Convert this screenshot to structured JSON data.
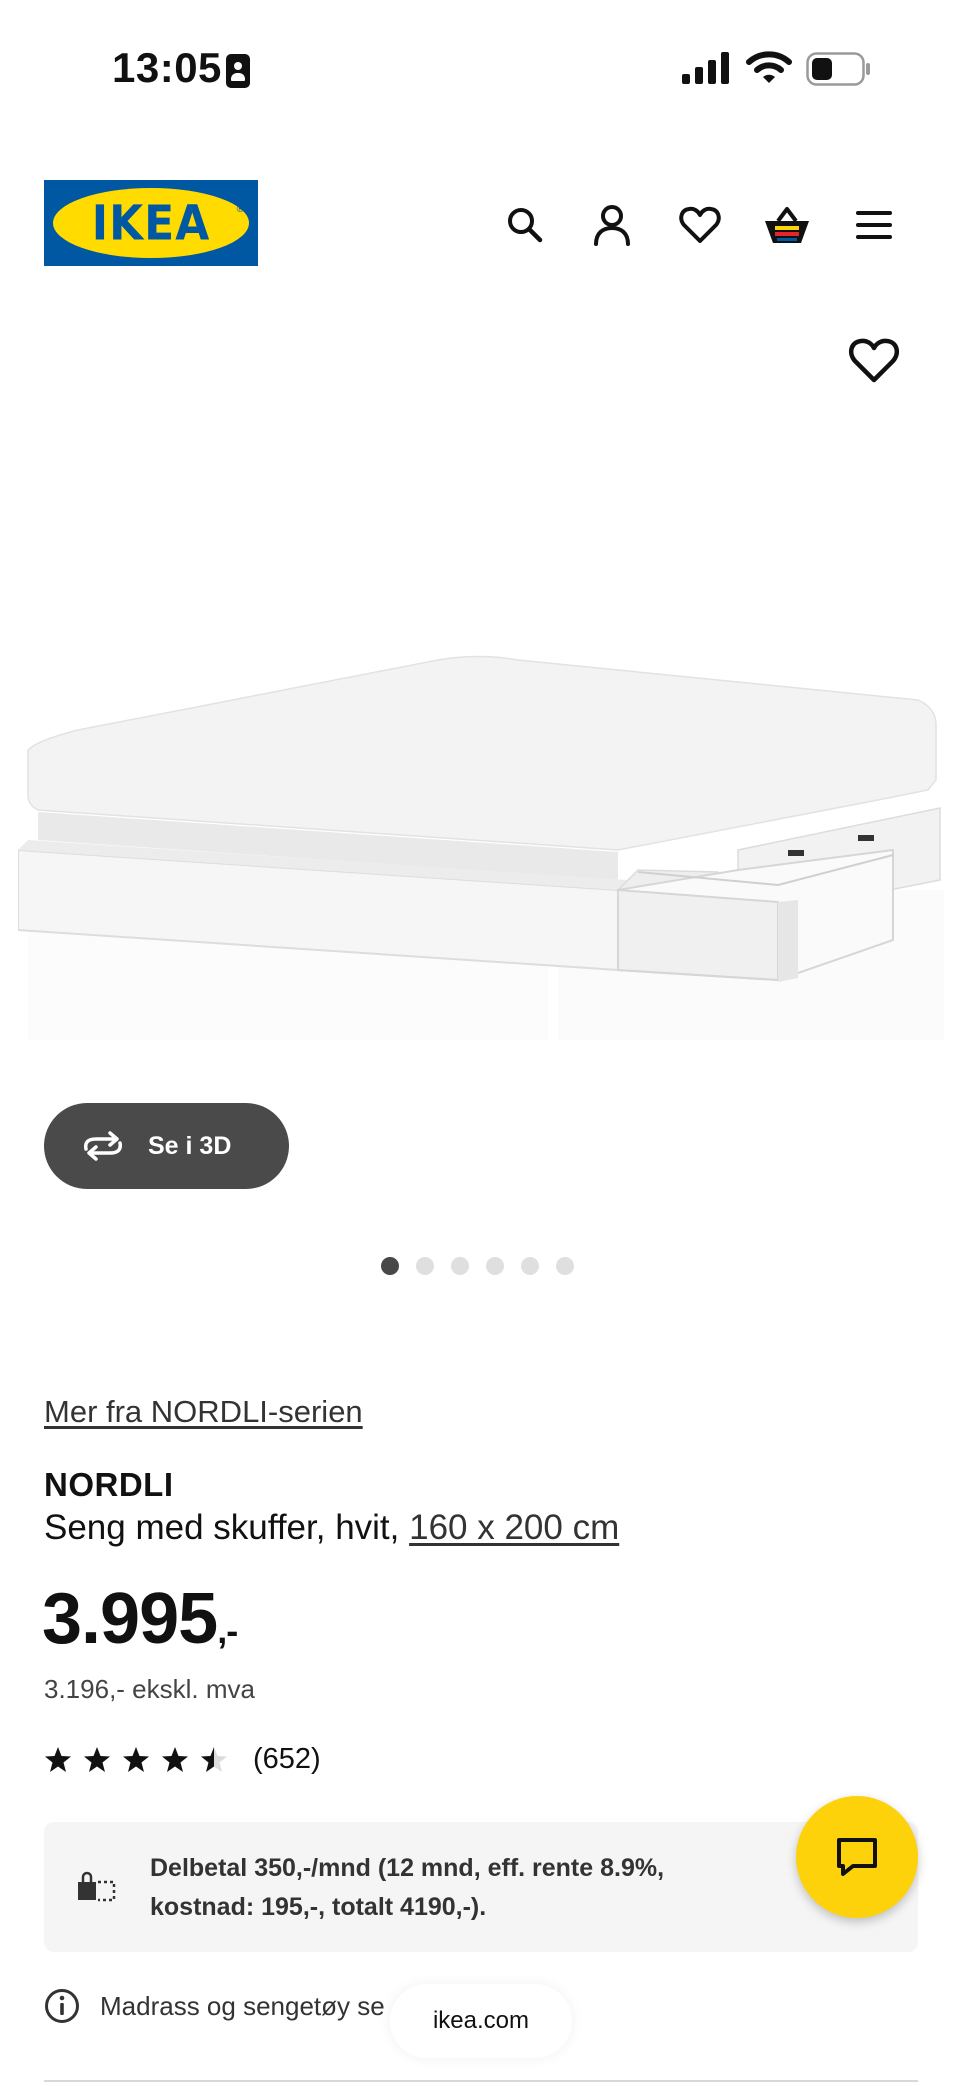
{
  "status_bar": {
    "time": "13:05"
  },
  "header": {
    "logo_text": "IKEA",
    "logo_reg": "®",
    "brand_colors": {
      "blue": "#0058a3",
      "yellow": "#ffdb00"
    },
    "icons": [
      "search-icon",
      "account-icon",
      "heart-icon",
      "basket-icon",
      "menu-icon"
    ]
  },
  "gallery": {
    "view_3d_label": "Se i 3D",
    "image_count": 6,
    "active_index": 0
  },
  "product": {
    "series_link": "Mer fra NORDLI-serien",
    "name": "NORDLI",
    "description": "Seng med skuffer, hvit, ",
    "size": "160 x 200 cm",
    "price": "3.995",
    "price_suffix": ",-",
    "price_ex_vat": "3.196,- ekskl. mva",
    "rating_value": 4.5,
    "rating_count": "(652)"
  },
  "finance": {
    "text": "Delbetal 350,-/mnd (12 mnd, eff. rente 8.9%, kostnad: 195,-, totalt 4190,-)."
  },
  "info": {
    "text": "Madrass og sengetøy se"
  },
  "browser": {
    "url": "ikea.com"
  },
  "colors": {
    "chat_yellow": "#fdd20a",
    "button_dark": "#4a4a4a"
  }
}
